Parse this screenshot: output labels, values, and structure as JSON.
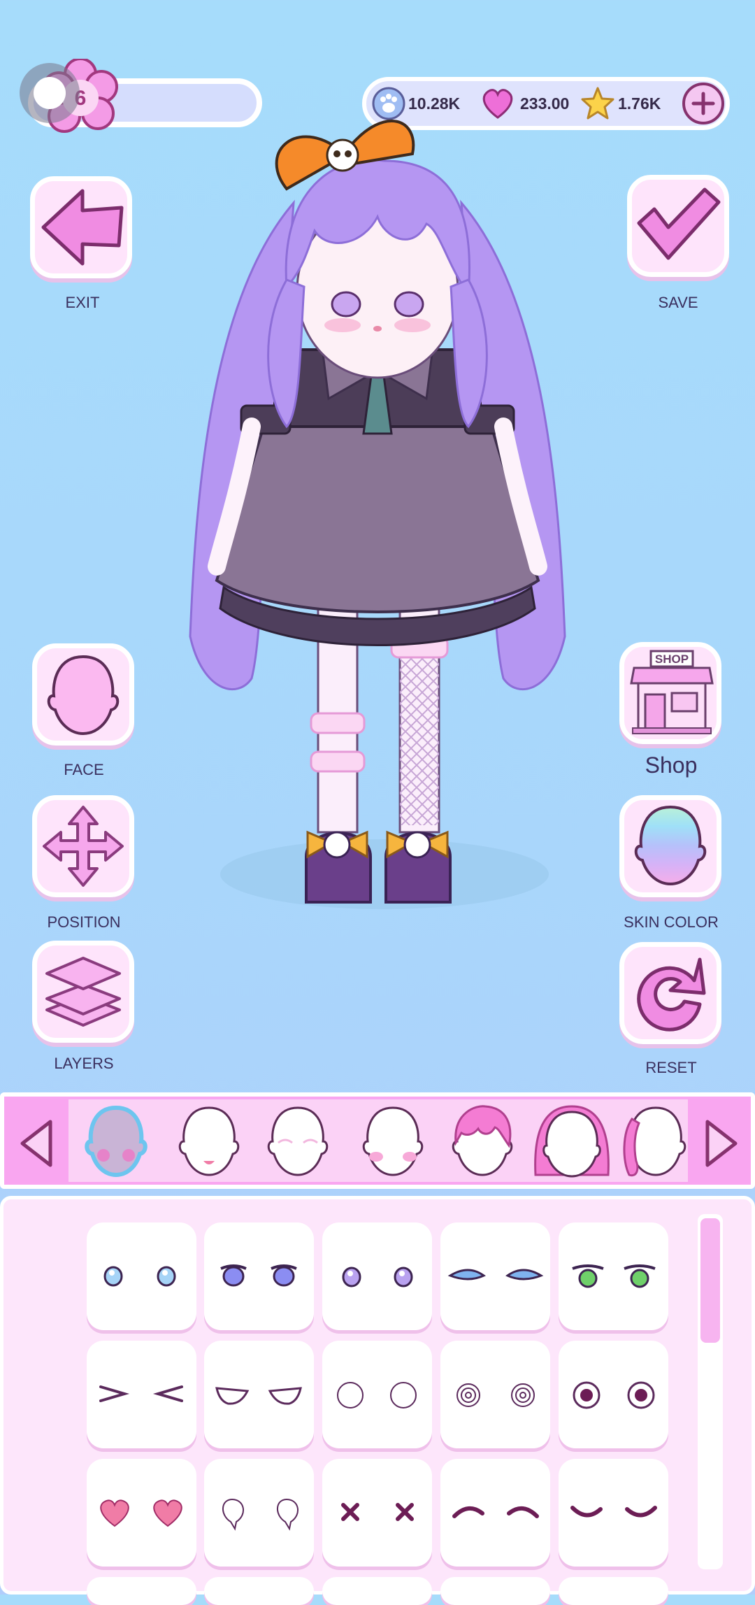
{
  "top_bar": {
    "currency_paw": "10.28K",
    "currency_heart": "233.00",
    "currency_star": "1.76K",
    "level_badge": "6"
  },
  "left_buttons": [
    {
      "label": "EXIT",
      "icon": "back-arrow-icon"
    },
    {
      "label": "FACE",
      "icon": "face-icon"
    },
    {
      "label": "POSITION",
      "icon": "move-arrows-icon"
    },
    {
      "label": "LAYERS",
      "icon": "layers-icon"
    }
  ],
  "right_buttons": [
    {
      "label": "SAVE",
      "icon": "checkmark-icon"
    },
    {
      "label": "Shop",
      "icon": "shop-icon",
      "sign": "SHOP"
    },
    {
      "label": "SKIN COLOR",
      "icon": "rainbow-head-icon"
    },
    {
      "label": "RESET",
      "icon": "refresh-icon"
    }
  ],
  "categories": [
    "face-base",
    "mouth",
    "eyebrows",
    "blush",
    "front-hair",
    "back-hair",
    "side-hair"
  ],
  "selected_category": 0,
  "eye_options": [
    "sparkle-blue-eyes",
    "blue-round-eyes",
    "purple-sparkle-eyes",
    "blue-sharp-eyes",
    "green-eyes",
    "squint-eyes",
    "half-lid-eyes",
    "blank-circle-eyes",
    "swirl-eyes",
    "dot-eyes",
    "heart-eyes",
    "teardrop-eyes",
    "x-eyes",
    "arched-closed-eyes",
    "smile-closed-eyes"
  ],
  "colors": {
    "background_top": "#a6dcfb",
    "accent_pink": "#f9a6f0",
    "panel": "#fde6fb",
    "outline": "#86326e"
  }
}
